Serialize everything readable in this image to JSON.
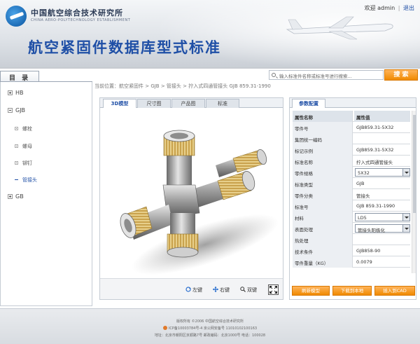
{
  "header": {
    "institute_name": "中国航空综合技术研究所",
    "institute_sub": "CHINA AERO-POLYTECHNOLOGY ESTABLISHMENT",
    "site_title": "航空紧固件数据库型式标准",
    "welcome": "欢迎 admin",
    "separator": "|",
    "logout": "退出"
  },
  "sidebar": {
    "title": "目 录",
    "nodes": [
      {
        "label": "HB"
      },
      {
        "label": "GJB"
      },
      {
        "label": "GB"
      }
    ],
    "leaves": [
      {
        "label": "螺栓"
      },
      {
        "label": "螺母"
      },
      {
        "label": "铆钉"
      },
      {
        "label": "管接头"
      }
    ]
  },
  "search": {
    "placeholder": "输入标准件名称或标准号进行搜索...",
    "button": "搜 索"
  },
  "breadcrumb": "当前位置：航空紧固件 > GJB > 管接头 > 拧入式四通管接头 GJB 859.31-1990",
  "viewer": {
    "tabs": [
      "3D模型",
      "尺寸图",
      "产品图",
      "标准"
    ],
    "tools": [
      "左键",
      "右键",
      "双键"
    ]
  },
  "params": {
    "tab": "参数配置",
    "header": {
      "name": "属性名称",
      "value": "属性值"
    },
    "rows": [
      {
        "name": "零件号",
        "value": "GJB859.31-5X32"
      },
      {
        "name": "集团统一编码",
        "value": ""
      },
      {
        "name": "标记示例",
        "value": "GJB859.31-5X32"
      },
      {
        "name": "标准名称",
        "value": "拧入式四通管接头"
      },
      {
        "name": "零件规格",
        "value": "5X32"
      },
      {
        "name": "标准类型",
        "value": "GJB"
      },
      {
        "name": "零件分类",
        "value": "管接头"
      },
      {
        "name": "标准号",
        "value": "GJB 859.31-1990"
      },
      {
        "name": "材料",
        "value": "LD5"
      },
      {
        "name": "表面处理",
        "value": "管接头阳极化"
      },
      {
        "name": "热处理",
        "value": ""
      },
      {
        "name": "技术条件",
        "value": "GJB858-90"
      },
      {
        "name": "零件重量（KG）",
        "value": "0.0079"
      }
    ],
    "buttons": [
      "刷新模型",
      "下载到本地",
      "插入到CAD"
    ]
  },
  "footer": {
    "line1": "版权所有 ©2006 中国航空综合技术研究所",
    "line2": "ICP备10003784号-4  京公网安备号 11010102100163",
    "line3": "地址：北京市朝阳区京顺路7号  邮政编码：北京1000号  电话：100028"
  },
  "colors": {
    "accent": "#f08a00",
    "brand": "#1f4fa6"
  }
}
